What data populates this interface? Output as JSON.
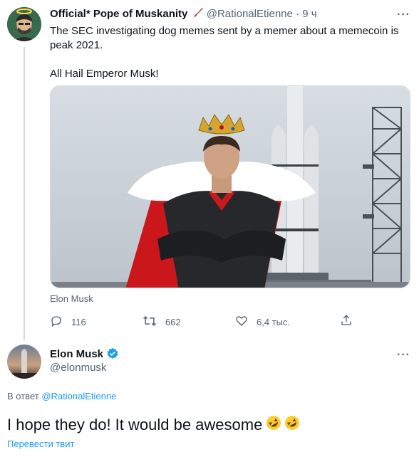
{
  "tweet1": {
    "author_name": "Official* Pope of Muskanity",
    "handle": "@RationalEtienne",
    "separator": "·",
    "time": "9 ч",
    "text_line1": "The SEC investigating dog memes sent by a memer about a memecoin is peak 2021.",
    "text_line2": "All Hail Emperor Musk!",
    "media_caption": "Elon Musk",
    "actions": {
      "reply_count": "116",
      "retweet_count": "662",
      "like_count": "6,4 тыс."
    }
  },
  "tweet2": {
    "author_name": "Elon Musk",
    "handle": "@elonmusk",
    "reply_prefix": "В ответ",
    "reply_to": "@RationalEtienne",
    "text": "I hope they do! It would be awesome",
    "translate_link": "Перевести твит"
  },
  "icons": {
    "more": "more-dots-icon",
    "reply": "reply-icon",
    "retweet": "retweet-icon",
    "like": "heart-icon",
    "share": "share-icon",
    "verified": "verified-badge-icon",
    "brush": "paintbrush-emoji",
    "laugh": "rolling-on-floor-laughing-emoji"
  },
  "colors": {
    "link": "#1d9bf0",
    "muted": "#536471",
    "text": "#0f1419",
    "verified": "#1d9bf0"
  }
}
